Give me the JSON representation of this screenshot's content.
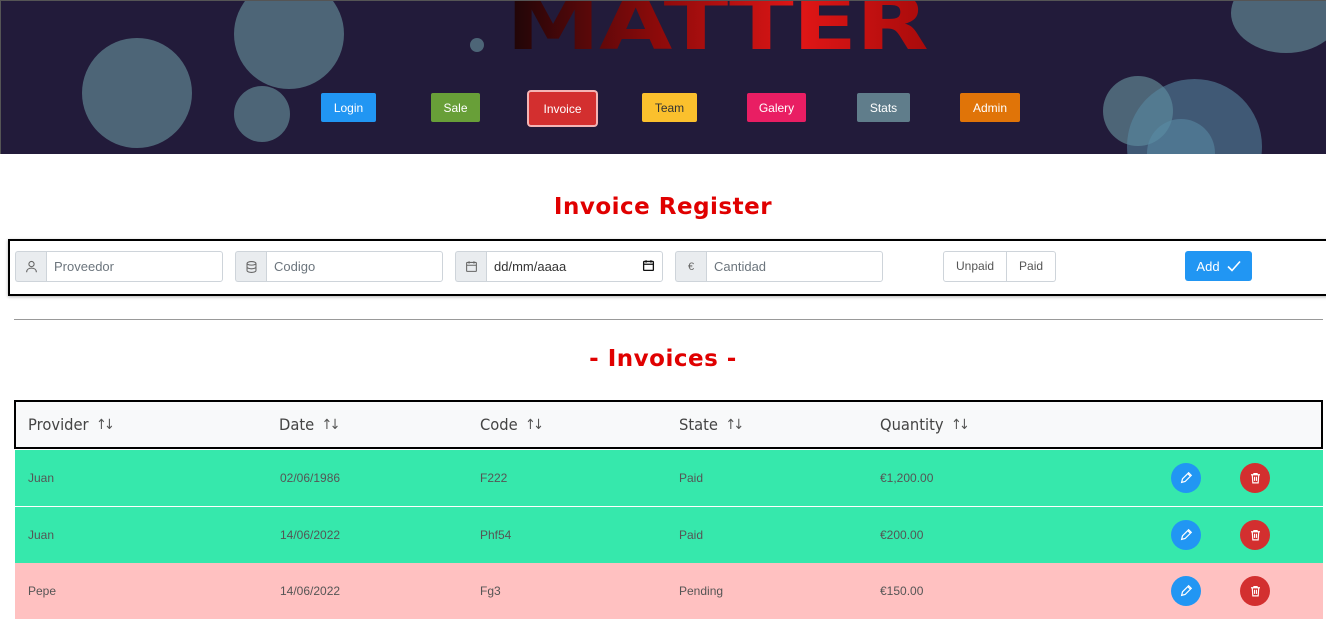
{
  "app": {
    "logo_text": "MATTER"
  },
  "nav": [
    {
      "label": "Login"
    },
    {
      "label": "Sale"
    },
    {
      "label": "Invoice"
    },
    {
      "label": "Team"
    },
    {
      "label": "Galery"
    },
    {
      "label": "Stats"
    },
    {
      "label": "Admin"
    }
  ],
  "register": {
    "title": "Invoice Register",
    "provider_placeholder": "Proveedor",
    "code_placeholder": "Codigo",
    "date_value": "dd/mm/aaaa",
    "quantity_prefix": "€",
    "quantity_placeholder": "Cantidad",
    "state_options": [
      "Unpaid",
      "Paid"
    ],
    "add_label": "Add"
  },
  "invoices": {
    "title": "- Invoices -",
    "columns": [
      "Provider",
      "Date",
      "Code",
      "State",
      "Quantity"
    ],
    "rows": [
      {
        "provider": "Juan",
        "date": "02/06/1986",
        "code": "F222",
        "state": "Paid",
        "quantity": "€1,200.00"
      },
      {
        "provider": "Juan",
        "date": "14/06/2022",
        "code": "Phf54",
        "state": "Paid",
        "quantity": "€200.00"
      },
      {
        "provider": "Pepe",
        "date": "14/06/2022",
        "code": "Fg3",
        "state": "Pending",
        "quantity": "€150.00"
      }
    ]
  },
  "colors": {
    "header_bg": "#221b3a",
    "title_red": "#e00000",
    "paid_row": "#36e8ac",
    "pending_row": "#ffc1c1",
    "primary": "#2196f3",
    "danger": "#d32f2f"
  },
  "icons": [
    "user-icon",
    "database-icon",
    "calendar-icon",
    "euro-icon",
    "check-icon",
    "sort-icon",
    "pencil-icon",
    "trash-icon"
  ]
}
